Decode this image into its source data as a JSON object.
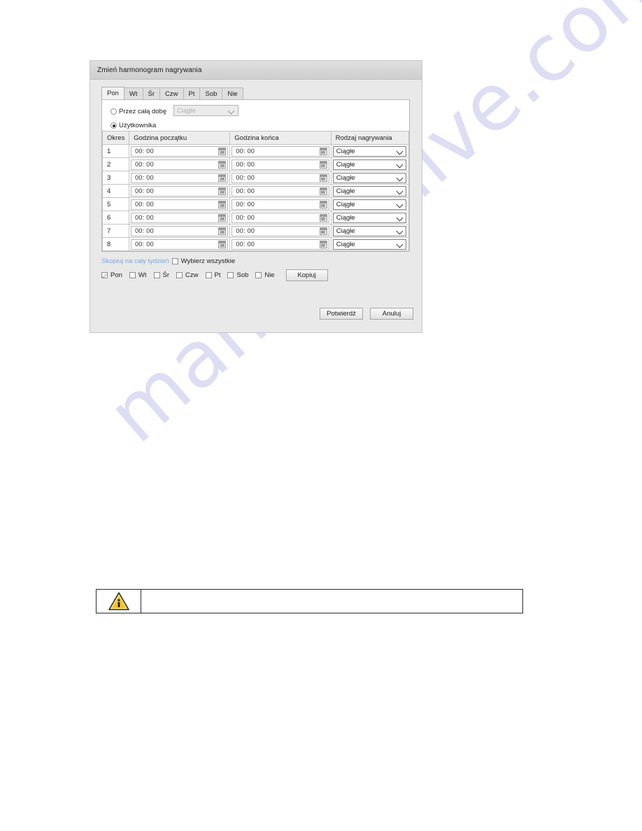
{
  "dialog": {
    "title": "Zmień harmonogram nagrywania",
    "tabs": [
      {
        "label": "Pon",
        "active": true
      },
      {
        "label": "Wt",
        "active": false
      },
      {
        "label": "Śr",
        "active": false
      },
      {
        "label": "Czw",
        "active": false
      },
      {
        "label": "Pt",
        "active": false
      },
      {
        "label": "Sob",
        "active": false
      },
      {
        "label": "Nie",
        "active": false
      }
    ],
    "mode": {
      "all_day_label": "Przez całą dobę",
      "all_day_selected": false,
      "all_day_type_value": "Ciągłe",
      "custom_label": "Użytkownika",
      "custom_selected": true
    },
    "table": {
      "headers": [
        "Okres",
        "Godzina początku",
        "Godzina końca",
        "Rodzaj nagrywania"
      ],
      "rows": [
        {
          "period": "1",
          "start": "00: 00",
          "end": "00: 00",
          "type": "Ciągłe"
        },
        {
          "period": "2",
          "start": "00: 00",
          "end": "00: 00",
          "type": "Ciągłe"
        },
        {
          "period": "3",
          "start": "00: 00",
          "end": "00: 00",
          "type": "Ciągłe"
        },
        {
          "period": "4",
          "start": "00: 00",
          "end": "00: 00",
          "type": "Ciągłe"
        },
        {
          "period": "5",
          "start": "00: 00",
          "end": "00: 00",
          "type": "Ciągłe"
        },
        {
          "period": "6",
          "start": "00: 00",
          "end": "00: 00",
          "type": "Ciągłe"
        },
        {
          "period": "7",
          "start": "00: 00",
          "end": "00: 00",
          "type": "Ciągłe"
        },
        {
          "period": "8",
          "start": "00: 00",
          "end": "00: 00",
          "type": "Ciągłe"
        }
      ]
    },
    "copy": {
      "link_label": "Skopiuj na cały tydzień",
      "select_all_label": "Wybierz wszystkie",
      "select_all_checked": false,
      "days": [
        {
          "label": "Pon",
          "checked": true
        },
        {
          "label": "Wt",
          "checked": false
        },
        {
          "label": "Śr",
          "checked": false
        },
        {
          "label": "Czw",
          "checked": false
        },
        {
          "label": "Pt",
          "checked": false
        },
        {
          "label": "Sob",
          "checked": false
        },
        {
          "label": "Nie",
          "checked": false
        }
      ],
      "copy_button_label": "Kopiuj"
    },
    "footer": {
      "confirm_label": "Potwierdź",
      "cancel_label": "Anuluj"
    }
  },
  "note": {
    "icon": "warning-info-icon",
    "text": ""
  },
  "watermark": {
    "text": "manualshive.com"
  },
  "colors": {
    "link": "#7da7d9",
    "panel_bg": "#e9e9e9",
    "warning_yellow": "#f5c518"
  }
}
